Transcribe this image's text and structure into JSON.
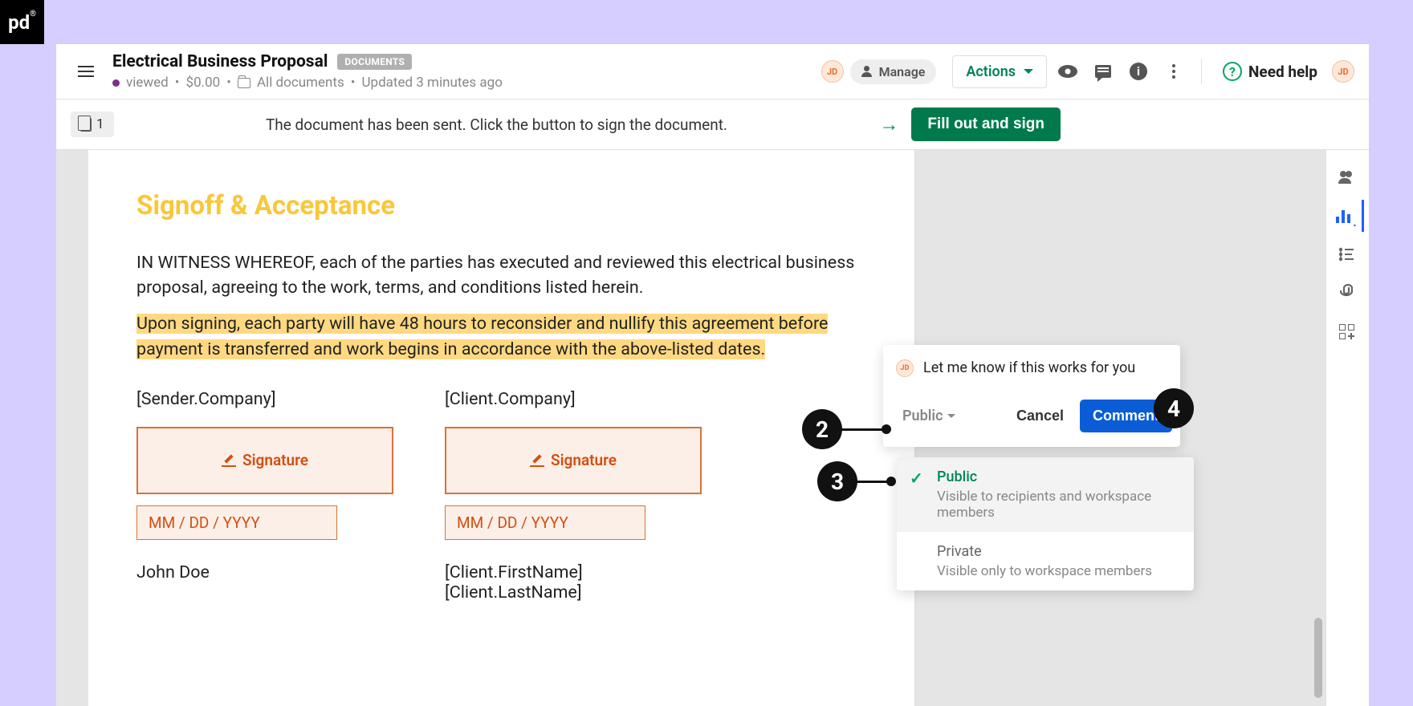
{
  "logo": "pd",
  "header": {
    "title": "Electrical Business Proposal",
    "badge": "DOCUMENTS",
    "status": "viewed",
    "price": "$0.00",
    "folder": "All documents",
    "updated": "Updated 3 minutes ago",
    "user_initials": "JD",
    "manage": "Manage",
    "actions": "Actions",
    "help": "Need help"
  },
  "toolbar": {
    "page_count": "1",
    "notice": "The document has been sent. Click the button to sign the document.",
    "fill_sign": "Fill out and sign"
  },
  "document": {
    "heading": "Signoff & Acceptance",
    "para1": "IN WITNESS WHEREOF, each of the parties has executed and reviewed this electrical business proposal, agreeing to the work, terms, and conditions listed herein.",
    "para2": "Upon signing, each party will have 48 hours to reconsider and nullify this agreement before payment is transferred and work begins in accordance with the above-listed dates.",
    "left": {
      "company_token": "[Sender.Company]",
      "sig_label": "Signature",
      "date_placeholder": "MM / DD / YYYY",
      "name": "John Doe"
    },
    "right": {
      "company_token": "[Client.Company]",
      "sig_label": "Signature",
      "date_placeholder": "MM / DD / YYYY",
      "name": "[Client.FirstName] [Client.LastName]"
    }
  },
  "comment": {
    "author_initials": "JD",
    "text": "Let me know if this works for you",
    "visibility_label": "Public",
    "cancel": "Cancel",
    "submit": "Comment"
  },
  "visibility_options": [
    {
      "title": "Public",
      "desc": "Visible to recipients and workspace members",
      "selected": true
    },
    {
      "title": "Private",
      "desc": "Visible only to workspace members",
      "selected": false
    }
  ],
  "annotations": {
    "a2": "2",
    "a3": "3",
    "a4": "4"
  }
}
